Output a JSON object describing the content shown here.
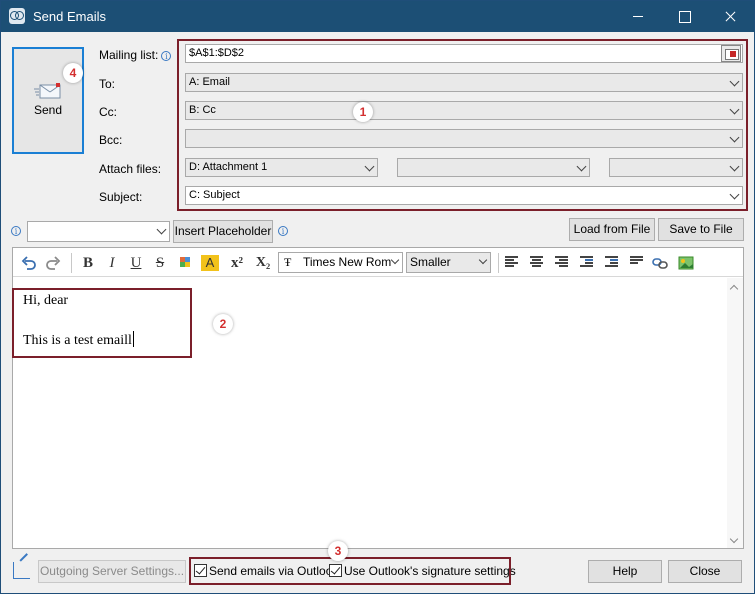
{
  "window": {
    "title": "Send Emails"
  },
  "send": {
    "label": "Send"
  },
  "fields": {
    "mailing_list_label": "Mailing list:",
    "mailing_list_value": "$A$1:$D$2",
    "to_label": "To:",
    "to_value": "A: Email",
    "cc_label": "Cc:",
    "cc_value": "B: Cc",
    "bcc_label": "Bcc:",
    "bcc_value": "",
    "attach_label": "Attach files:",
    "attach_values": [
      "D: Attachment 1",
      "",
      ""
    ],
    "subject_label": "Subject:",
    "subject_value": "C: Subject"
  },
  "placeholder_row": {
    "select_value": "",
    "insert_label": "Insert Placeholder",
    "load_label": "Load from File",
    "save_label": "Save to File"
  },
  "toolbar": {
    "bold": "B",
    "italic": "I",
    "underline": "U",
    "strike": "S",
    "superscript": "x²",
    "subscript": "X₂",
    "font_name": "Times New Rom",
    "font_size": "Smaller"
  },
  "editor": {
    "lines": [
      "Hi, dear",
      "This is a test emaill"
    ]
  },
  "footer": {
    "outgoing_label": "Outgoing Server Settings...",
    "via_outlook_label": "Send emails via Outlook",
    "signature_label": "Use Outlook's signature settings",
    "help_label": "Help",
    "close_label": "Close"
  },
  "badges": [
    "1",
    "2",
    "3",
    "4"
  ],
  "colors": {
    "titlebar": "#1c4f75",
    "highlight_box": "#7b1f2a",
    "badge_text": "#d32f2f",
    "send_border": "#1a7fd4"
  }
}
